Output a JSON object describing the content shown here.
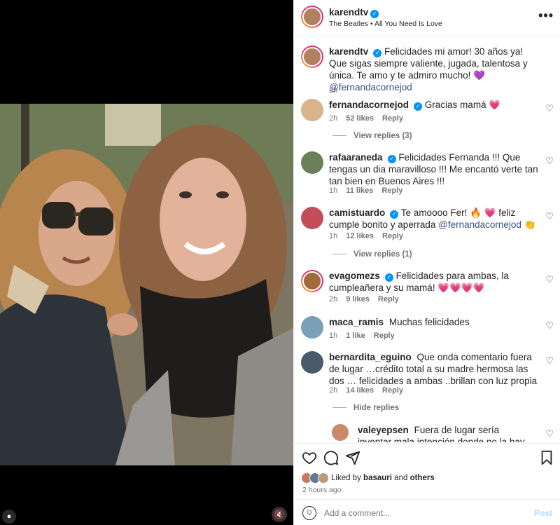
{
  "post": {
    "username": "karendtv",
    "song": "The Beatles • All You Need Is Love",
    "more_label": "•••",
    "time_ago": "2 hours ago"
  },
  "caption": {
    "username": "karendtv",
    "text": "Felicidades mi amor! 30 años ya! Que sigas siempre valiente, jugada, talentosa y única. Te amo y te admiro mucho! 💜",
    "mention": "@fernandacornejod",
    "time": "2h"
  },
  "comments": [
    {
      "username": "fernandacornejod",
      "verified": true,
      "text": "Gracias mamá 💗",
      "time": "2h",
      "likes": "52 likes",
      "reply": "Reply",
      "replies_label": "View replies (3)",
      "avatar_color": "#d8b48a"
    },
    {
      "username": "rafaaraneda",
      "verified": true,
      "text": "Felicidades Fernanda !!! Que tengas un dia maravilloso !!! Me encantó verte tan tan bien en Buenos Aires !!!",
      "time": "1h",
      "likes": "11 likes",
      "reply": "Reply",
      "avatar_color": "#6b7f5a"
    },
    {
      "username": "camistuardo",
      "verified": true,
      "text": "Te amoooo Fer! 🔥 💗 feliz cumple bonito y aperrada",
      "mention": "@fernandacornejod",
      "suffix": "👏",
      "time": "1h",
      "likes": "12 likes",
      "reply": "Reply",
      "replies_label": "View replies (1)",
      "avatar_color": "#c44d5a"
    },
    {
      "username": "evagomezs",
      "verified": true,
      "text": "Felicidades para ambas, la cumpleañera y su mamá! 💗💗💗💗",
      "time": "2h",
      "likes": "9 likes",
      "reply": "Reply",
      "avatar_color": "#a06a3b"
    },
    {
      "username": "maca_ramis",
      "verified": false,
      "text": "Muchas felicidades",
      "time": "1h",
      "likes": "1 like",
      "reply": "Reply",
      "avatar_color": "#7aa0b8"
    },
    {
      "username": "bernardita_eguino",
      "verified": false,
      "text": "Que onda comentario fuera de lugar …crédito total a su madre hermosa las dos … felicidades a ambas ..brillan con luz propia",
      "time": "2h",
      "likes": "14 likes",
      "reply": "Reply",
      "replies_label": "Hide replies",
      "avatar_color": "#4a5a6a"
    },
    {
      "username": "valeyepsen",
      "verified": false,
      "text": "Fuera de lugar sería inventar mala intención donde no la hay, solo comenté algo real.",
      "avatar_color": "#c98a6a"
    }
  ],
  "likes": {
    "prefix": "Liked by",
    "user": "basauri",
    "middle": "and",
    "others": "others",
    "avatars": [
      "#c77a5a",
      "#5d7a9a",
      "#b89a7a"
    ]
  },
  "composer": {
    "placeholder": "Add a comment...",
    "post_label": "Post"
  },
  "icons": {
    "heart": "heart-icon",
    "comment": "comment-icon",
    "share": "share-icon",
    "save": "bookmark-icon",
    "mute": "muted-speaker-icon",
    "tag": "person-tag-icon",
    "emoji": "emoji-icon",
    "verified": "verified-badge-icon"
  }
}
